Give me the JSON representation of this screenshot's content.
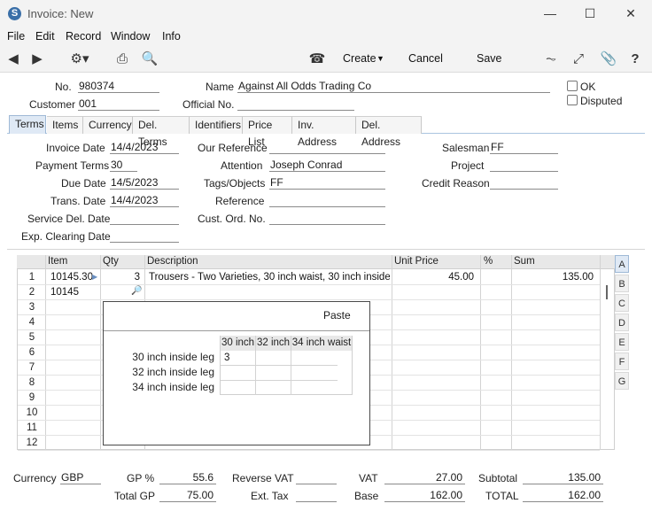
{
  "window": {
    "title": "Invoice: New",
    "app_icon": "S"
  },
  "menu": [
    "File",
    "Edit",
    "Record",
    "Window",
    "Info"
  ],
  "toolbar": {
    "create": "Create",
    "cancel": "Cancel",
    "save": "Save"
  },
  "header": {
    "no_label": "No.",
    "no_value": "980374",
    "name_label": "Name",
    "name_value": "Against All Odds Trading Co",
    "customer_label": "Customer",
    "customer_value": "001",
    "official_label": "Official No.",
    "official_value": "",
    "ok_label": "OK",
    "disputed_label": "Disputed"
  },
  "tabs": [
    "Terms",
    "Items",
    "Currency",
    "Del. Terms",
    "Identifiers",
    "Price List",
    "Inv. Address",
    "Del. Address"
  ],
  "terms": {
    "invoice_date_label": "Invoice Date",
    "invoice_date": "14/4/2023",
    "payment_terms_label": "Payment Terms",
    "payment_terms": "30",
    "due_date_label": "Due Date",
    "due_date": "14/5/2023",
    "trans_date_label": "Trans. Date",
    "trans_date": "14/4/2023",
    "service_del_label": "Service Del. Date",
    "service_del": "",
    "exp_clearing_label": "Exp. Clearing Date",
    "exp_clearing": "",
    "our_ref_label": "Our Reference",
    "our_ref": "",
    "attention_label": "Attention",
    "attention": "Joseph Conrad",
    "tags_label": "Tags/Objects",
    "tags": "FF",
    "reference_label": "Reference",
    "reference": "",
    "cust_ord_label": "Cust. Ord. No.",
    "cust_ord": "",
    "salesman_label": "Salesman",
    "salesman": "FF",
    "project_label": "Project",
    "project": "",
    "credit_reason_label": "Credit Reason",
    "credit_reason": ""
  },
  "grid": {
    "headers": {
      "item": "Item",
      "qty": "Qty",
      "description": "Description",
      "unit_price": "Unit Price",
      "pct": "%",
      "sum": "Sum"
    },
    "rows": [
      {
        "n": "1",
        "item": "10145.30",
        "qty": "3",
        "description": "Trousers - Two Varieties, 30 inch waist, 30 inch inside leg",
        "unit_price": "45.00",
        "sum": "135.00"
      },
      {
        "n": "2",
        "item": "10145",
        "qty": "",
        "description": "",
        "unit_price": "",
        "sum": ""
      },
      {
        "n": "3"
      },
      {
        "n": "4"
      },
      {
        "n": "5"
      },
      {
        "n": "6"
      },
      {
        "n": "7"
      },
      {
        "n": "8"
      },
      {
        "n": "9"
      },
      {
        "n": "10"
      },
      {
        "n": "11"
      },
      {
        "n": "12"
      }
    ],
    "side_buttons": [
      "A",
      "B",
      "C",
      "D",
      "E",
      "F",
      "G"
    ]
  },
  "popup": {
    "paste": "Paste",
    "col_headers": [
      "30 inch",
      "32 inch",
      "34 inch waist"
    ],
    "row_labels": [
      "30 inch inside leg",
      "32 inch inside leg",
      "34 inch inside leg"
    ],
    "cells": [
      [
        "3",
        "",
        ""
      ],
      [
        "",
        "",
        ""
      ],
      [
        "",
        "",
        ""
      ]
    ]
  },
  "footer": {
    "currency_label": "Currency",
    "currency": "GBP",
    "gp_pct_label": "GP %",
    "gp_pct": "55.6",
    "total_gp_label": "Total GP",
    "total_gp": "75.00",
    "reverse_vat_label": "Reverse VAT",
    "reverse_vat": "",
    "ext_tax_label": "Ext. Tax",
    "ext_tax": "",
    "vat_label": "VAT",
    "vat": "27.00",
    "base_label": "Base",
    "base": "162.00",
    "subtotal_label": "Subtotal",
    "subtotal": "135.00",
    "total_label": "TOTAL",
    "total": "162.00"
  }
}
